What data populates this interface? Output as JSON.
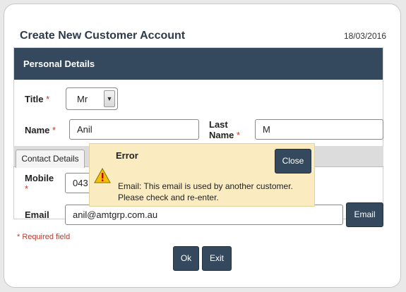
{
  "form": {
    "title": "Create New Customer Account",
    "date": "18/03/2016",
    "section_title": "Personal Details",
    "required_marker": "*",
    "fields": {
      "title_label": "Title",
      "title_value": "Mr",
      "name_label": "Name",
      "name_value": "Anil",
      "last_name_label_line1": "Last",
      "last_name_label_line2": "Name",
      "last_name_value": "M",
      "mobile_label": "Mobile",
      "mobile_value": "043",
      "email_label": "Email",
      "email_value": "anil@amtgrp.com.au"
    },
    "tabs": [
      "Contact Details"
    ],
    "email_button": "Email",
    "required_note": "* Required field",
    "ok_button": "Ok",
    "exit_button": "Exit"
  },
  "error_popup": {
    "title": "Error",
    "close_label": "Close",
    "message": "Email: This email is used by another customer. Please check and re-enter.",
    "icon": "warning-icon"
  },
  "colors": {
    "header": "#34485e",
    "required": "#c0392b",
    "popup_bg": "#faebc0"
  }
}
